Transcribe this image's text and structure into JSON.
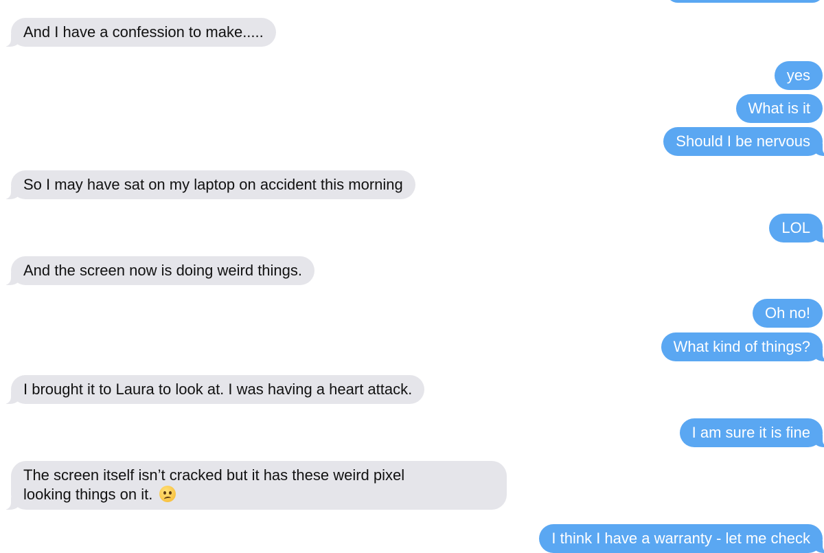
{
  "messages": [
    {
      "from": "them",
      "text": "And I have a confession to make....."
    },
    {
      "from": "me",
      "text": "yes"
    },
    {
      "from": "me",
      "text": "What is it"
    },
    {
      "from": "me",
      "text": "Should I be nervous"
    },
    {
      "from": "them",
      "text": "So I may have sat on my laptop on accident this morning"
    },
    {
      "from": "me",
      "text": "LOL"
    },
    {
      "from": "them",
      "text": "And the screen now is doing weird things."
    },
    {
      "from": "me",
      "text": "Oh no!"
    },
    {
      "from": "me",
      "text": "What kind of things?"
    },
    {
      "from": "them",
      "text": "I brought it to Laura to look at.  I was having a heart attack."
    },
    {
      "from": "me",
      "text": "I am sure it is fine"
    },
    {
      "from": "them",
      "text_line1": "The screen itself isn’t cracked but it has these weird pixel",
      "text_line2": "looking things on it.",
      "emoji": "worried-face-icon"
    },
    {
      "from": "me",
      "text": "I think I have a warranty - let me check"
    }
  ],
  "colors": {
    "incoming_bubble": "#e5e5ea",
    "outgoing_bubble": "#5aa7f2",
    "incoming_text": "#111111",
    "outgoing_text": "#ffffff"
  }
}
